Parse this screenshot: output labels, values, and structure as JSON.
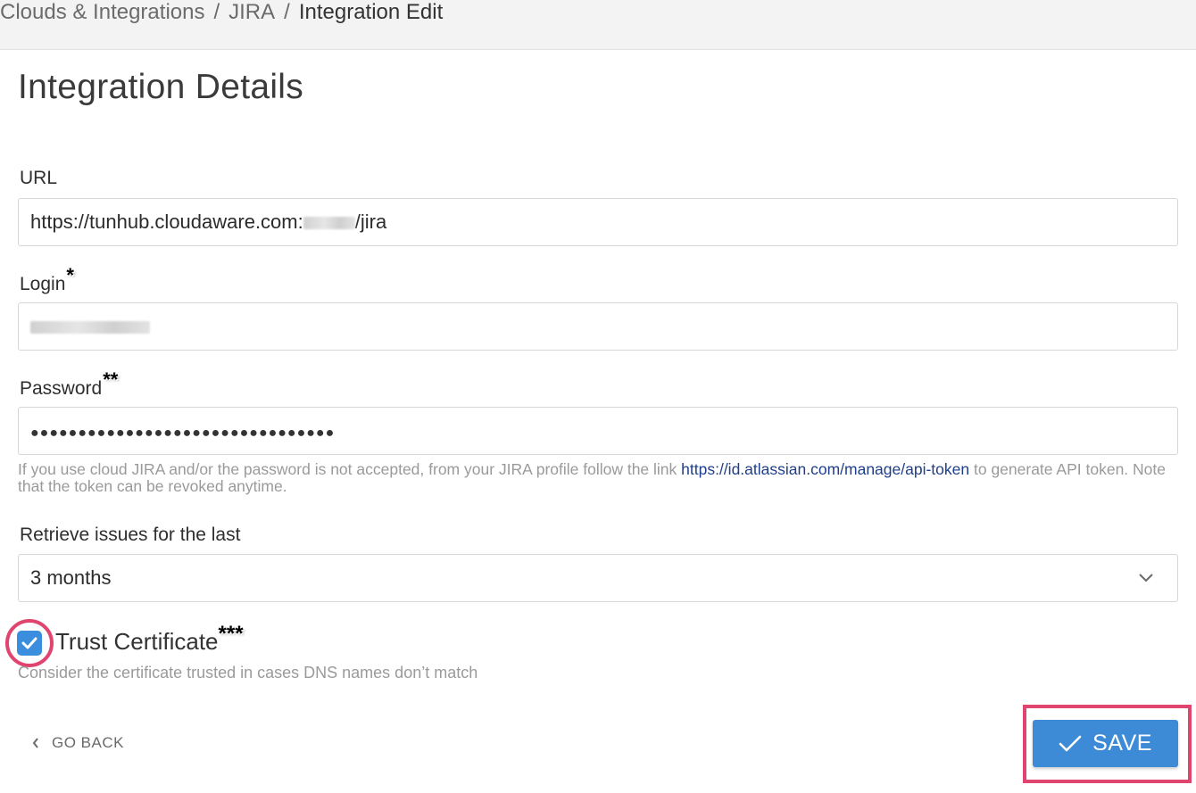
{
  "breadcrumb": {
    "items": [
      "Clouds & Integrations",
      "JIRA"
    ],
    "separator": "/",
    "current": "Integration Edit"
  },
  "page_title": "Integration Details",
  "form": {
    "url": {
      "label": "URL",
      "value_prefix": "https://tunhub.cloudaware.com:",
      "value_suffix": "/jira"
    },
    "login": {
      "label": "Login",
      "required_mark": "*"
    },
    "password": {
      "label": "Password",
      "required_mark": "**",
      "masked_value": "●●●●●●●●●●●●●●●●●●●●●●●●●●●●●●●●",
      "help_before": "If you use cloud JIRA and/or the password is not accepted, from your JIRA profile follow the link ",
      "help_link": "https://id.atlassian.com/manage/api-token",
      "help_after": " to generate API token. Note that the token can be revoked anytime."
    },
    "retrieve": {
      "label": "Retrieve issues for the last",
      "selected": "3 months"
    },
    "trust_certificate": {
      "label": "Trust Certificate",
      "required_mark": "***",
      "checked": true,
      "help": "Consider the certificate trusted in cases DNS names don’t match"
    }
  },
  "actions": {
    "go_back": "GO BACK",
    "save": "SAVE"
  },
  "colors": {
    "accent": "#3d8ad6",
    "highlight": "#e0456f",
    "link": "#1f3f8a"
  },
  "icons": {
    "back": "chevron-left-icon",
    "select": "chevron-down-icon",
    "save": "checkmark-icon",
    "checkbox": "checkbox-checked-icon"
  }
}
